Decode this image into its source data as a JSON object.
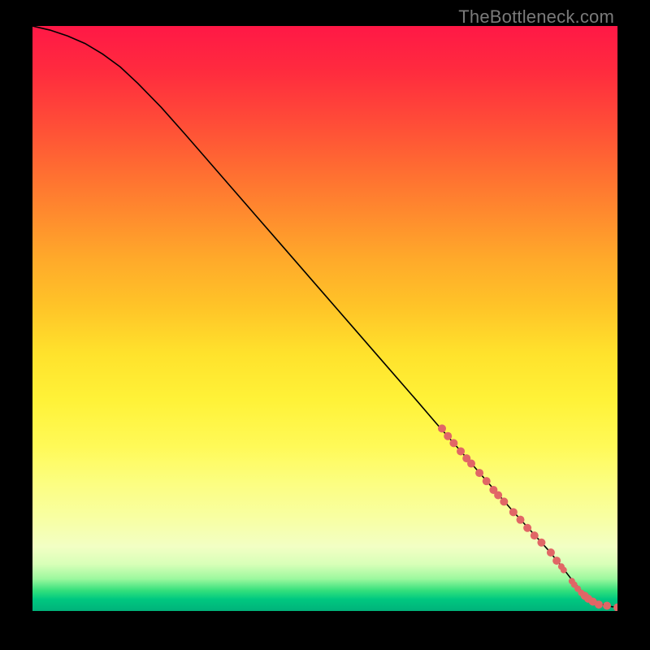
{
  "attribution": "TheBottleneck.com",
  "chart_data": {
    "type": "line",
    "title": "",
    "xlabel": "",
    "ylabel": "",
    "xlim": [
      0,
      100
    ],
    "ylim": [
      0,
      100
    ],
    "grid": false,
    "legend": false,
    "series": [
      {
        "name": "curve",
        "draw_as": "line",
        "color": "#000000",
        "x": [
          0,
          3,
          6,
          9,
          12,
          15,
          18,
          22,
          26,
          30,
          34,
          38,
          42,
          46,
          50,
          54,
          58,
          62,
          66,
          69,
          72,
          74,
          76,
          78,
          80,
          82,
          84,
          86,
          88,
          90,
          92,
          94,
          96,
          98,
          100
        ],
        "y": [
          100,
          99.3,
          98.3,
          97.0,
          95.2,
          93.0,
          90.2,
          86.1,
          81.6,
          77.0,
          72.4,
          67.8,
          63.2,
          58.6,
          54.0,
          49.4,
          44.8,
          40.2,
          35.6,
          32.1,
          28.7,
          26.4,
          24.1,
          21.8,
          19.5,
          17.2,
          15.0,
          12.8,
          10.6,
          8.2,
          5.6,
          3.2,
          1.6,
          0.9,
          0.6
        ]
      },
      {
        "name": "markers",
        "draw_as": "scatter",
        "color": "#e16666",
        "points": [
          {
            "x": 70.0,
            "y": 31.2,
            "r": 5
          },
          {
            "x": 71.0,
            "y": 29.9,
            "r": 5
          },
          {
            "x": 72.0,
            "y": 28.7,
            "r": 5
          },
          {
            "x": 73.2,
            "y": 27.3,
            "r": 5
          },
          {
            "x": 74.2,
            "y": 26.1,
            "r": 5
          },
          {
            "x": 75.0,
            "y": 25.2,
            "r": 5
          },
          {
            "x": 76.4,
            "y": 23.6,
            "r": 5
          },
          {
            "x": 77.6,
            "y": 22.2,
            "r": 5
          },
          {
            "x": 78.8,
            "y": 20.7,
            "r": 5
          },
          {
            "x": 79.6,
            "y": 19.8,
            "r": 5
          },
          {
            "x": 80.6,
            "y": 18.7,
            "r": 5
          },
          {
            "x": 82.2,
            "y": 16.9,
            "r": 5
          },
          {
            "x": 83.4,
            "y": 15.6,
            "r": 5
          },
          {
            "x": 84.6,
            "y": 14.2,
            "r": 5
          },
          {
            "x": 85.8,
            "y": 12.9,
            "r": 5
          },
          {
            "x": 87.0,
            "y": 11.7,
            "r": 5
          },
          {
            "x": 88.6,
            "y": 10.0,
            "r": 5
          },
          {
            "x": 89.6,
            "y": 8.6,
            "r": 5
          },
          {
            "x": 90.4,
            "y": 7.6,
            "r": 4
          },
          {
            "x": 90.8,
            "y": 7.0,
            "r": 4
          },
          {
            "x": 92.2,
            "y": 5.1,
            "r": 4
          },
          {
            "x": 92.6,
            "y": 4.5,
            "r": 4
          },
          {
            "x": 93.2,
            "y": 3.8,
            "r": 4
          },
          {
            "x": 93.8,
            "y": 3.1,
            "r": 4
          },
          {
            "x": 94.4,
            "y": 2.6,
            "r": 5
          },
          {
            "x": 95.0,
            "y": 2.1,
            "r": 5
          },
          {
            "x": 95.8,
            "y": 1.6,
            "r": 5
          },
          {
            "x": 96.8,
            "y": 1.1,
            "r": 5
          },
          {
            "x": 98.2,
            "y": 0.9,
            "r": 5
          },
          {
            "x": 100.0,
            "y": 0.6,
            "r": 5
          }
        ]
      }
    ]
  }
}
